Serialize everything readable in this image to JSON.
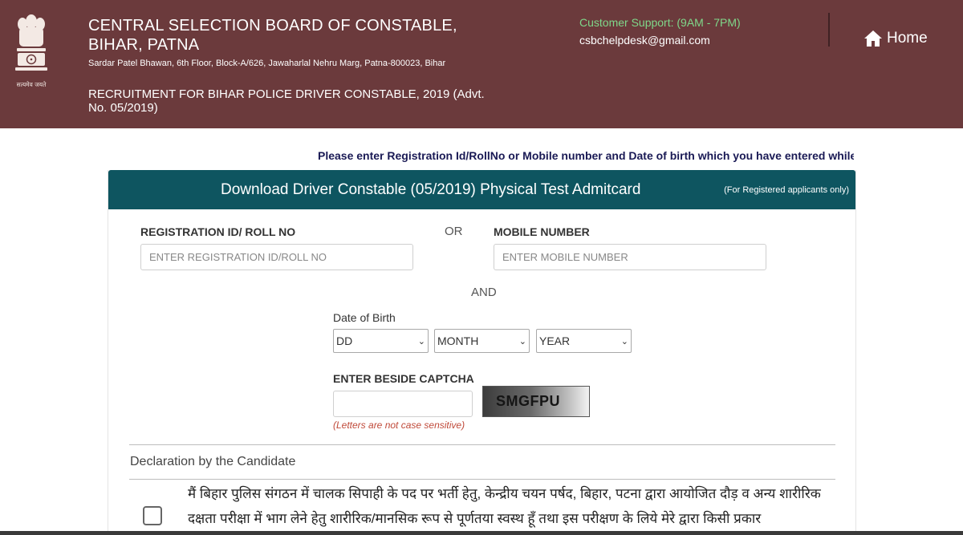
{
  "header": {
    "emblem_caption": "सत्यमेव जयते",
    "title": "CENTRAL SELECTION BOARD OF CONSTABLE, BIHAR, PATNA",
    "address": "Sardar Patel Bhawan, 6th Floor, Block-A/626, Jawaharlal Nehru Marg, Patna-800023, Bihar",
    "recruitment": "RECRUITMENT FOR BIHAR POLICE DRIVER CONSTABLE, 2019 (Advt. No. 05/2019)",
    "support_label": "Customer Support: (9AM - 7PM)",
    "support_email": "csbchelpdesk@gmail.com",
    "home_label": "Home",
    "home_icon": "home-icon"
  },
  "notice": "Please enter Registration Id/RollNo or Mobile number and Date of birth which you have entered while filling",
  "form": {
    "card_title": "Download Driver Constable (05/2019) Physical Test Admitcard",
    "card_note": "(For Registered applicants only)",
    "reg_label": "REGISTRATION ID/ ROLL NO",
    "reg_placeholder": "ENTER REGISTRATION ID/ROLL NO",
    "or_text": "OR",
    "mobile_label": "MOBILE NUMBER",
    "mobile_placeholder": "ENTER MOBILE NUMBER",
    "and_text": "AND",
    "dob_label": "Date of Birth",
    "dob_day": "DD",
    "dob_month": "MONTH",
    "dob_year": "YEAR",
    "captcha_label": "ENTER BESIDE CAPTCHA",
    "captcha_code": "SMGFPU",
    "captcha_hint": "(Letters are not case sensitive)"
  },
  "declaration": {
    "title": "Declaration by the Candidate",
    "text": "मैं बिहार पुलिस संगठन में चालक सिपाही के पद पर भर्ती हेतु, केन्द्रीय चयन पर्षद, बिहार, पटना द्वारा आयोजित दौड़ व अन्य शारीरिक दक्षता परीक्षा में भाग लेने हेतु शारीरिक/मानसिक रूप से पूर्णतया स्वस्थ हूँ तथा इस परीक्षण के लिये मेरे द्वारा किसी प्रकार",
    "checked": false
  },
  "colors": {
    "header_bg": "#6b3a3c",
    "card_header_bg": "#0e5560",
    "support_green": "#7fd88a",
    "hint_red": "#c04a3a"
  }
}
